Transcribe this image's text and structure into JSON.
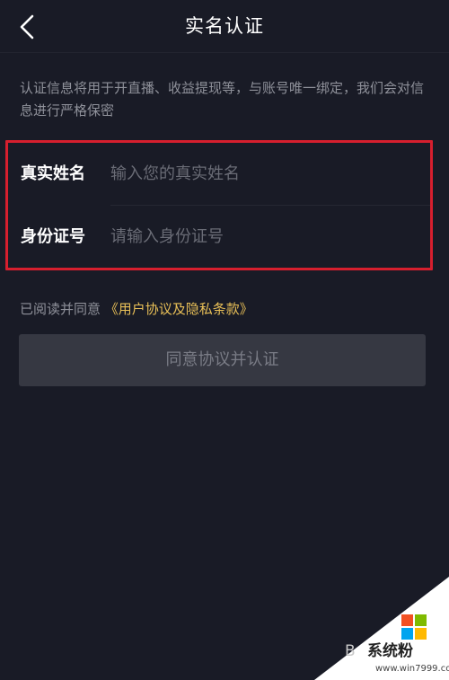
{
  "header": {
    "title": "实名认证",
    "back_icon": "chevron-left-icon"
  },
  "notice": {
    "text": "认证信息将用于开直播、收益提现等，与账号唯一绑定，我们会对信息进行严格保密"
  },
  "form": {
    "name": {
      "label": "真实姓名",
      "placeholder": "输入您的真实姓名",
      "value": ""
    },
    "id_number": {
      "label": "身份证号",
      "placeholder": "请输入身份证号",
      "value": ""
    },
    "highlight_color": "#d61f2e"
  },
  "agreement": {
    "prefix": "已阅读并同意",
    "link_text": "《用户协议及隐私条款》",
    "link_color": "#e8bf57"
  },
  "submit": {
    "label": "同意协议并认证"
  },
  "watermark": {
    "site_name": "系统粉",
    "url": "www.win7999.com",
    "partial_letter": "B",
    "logo_icon": "windows-logo-icon"
  }
}
